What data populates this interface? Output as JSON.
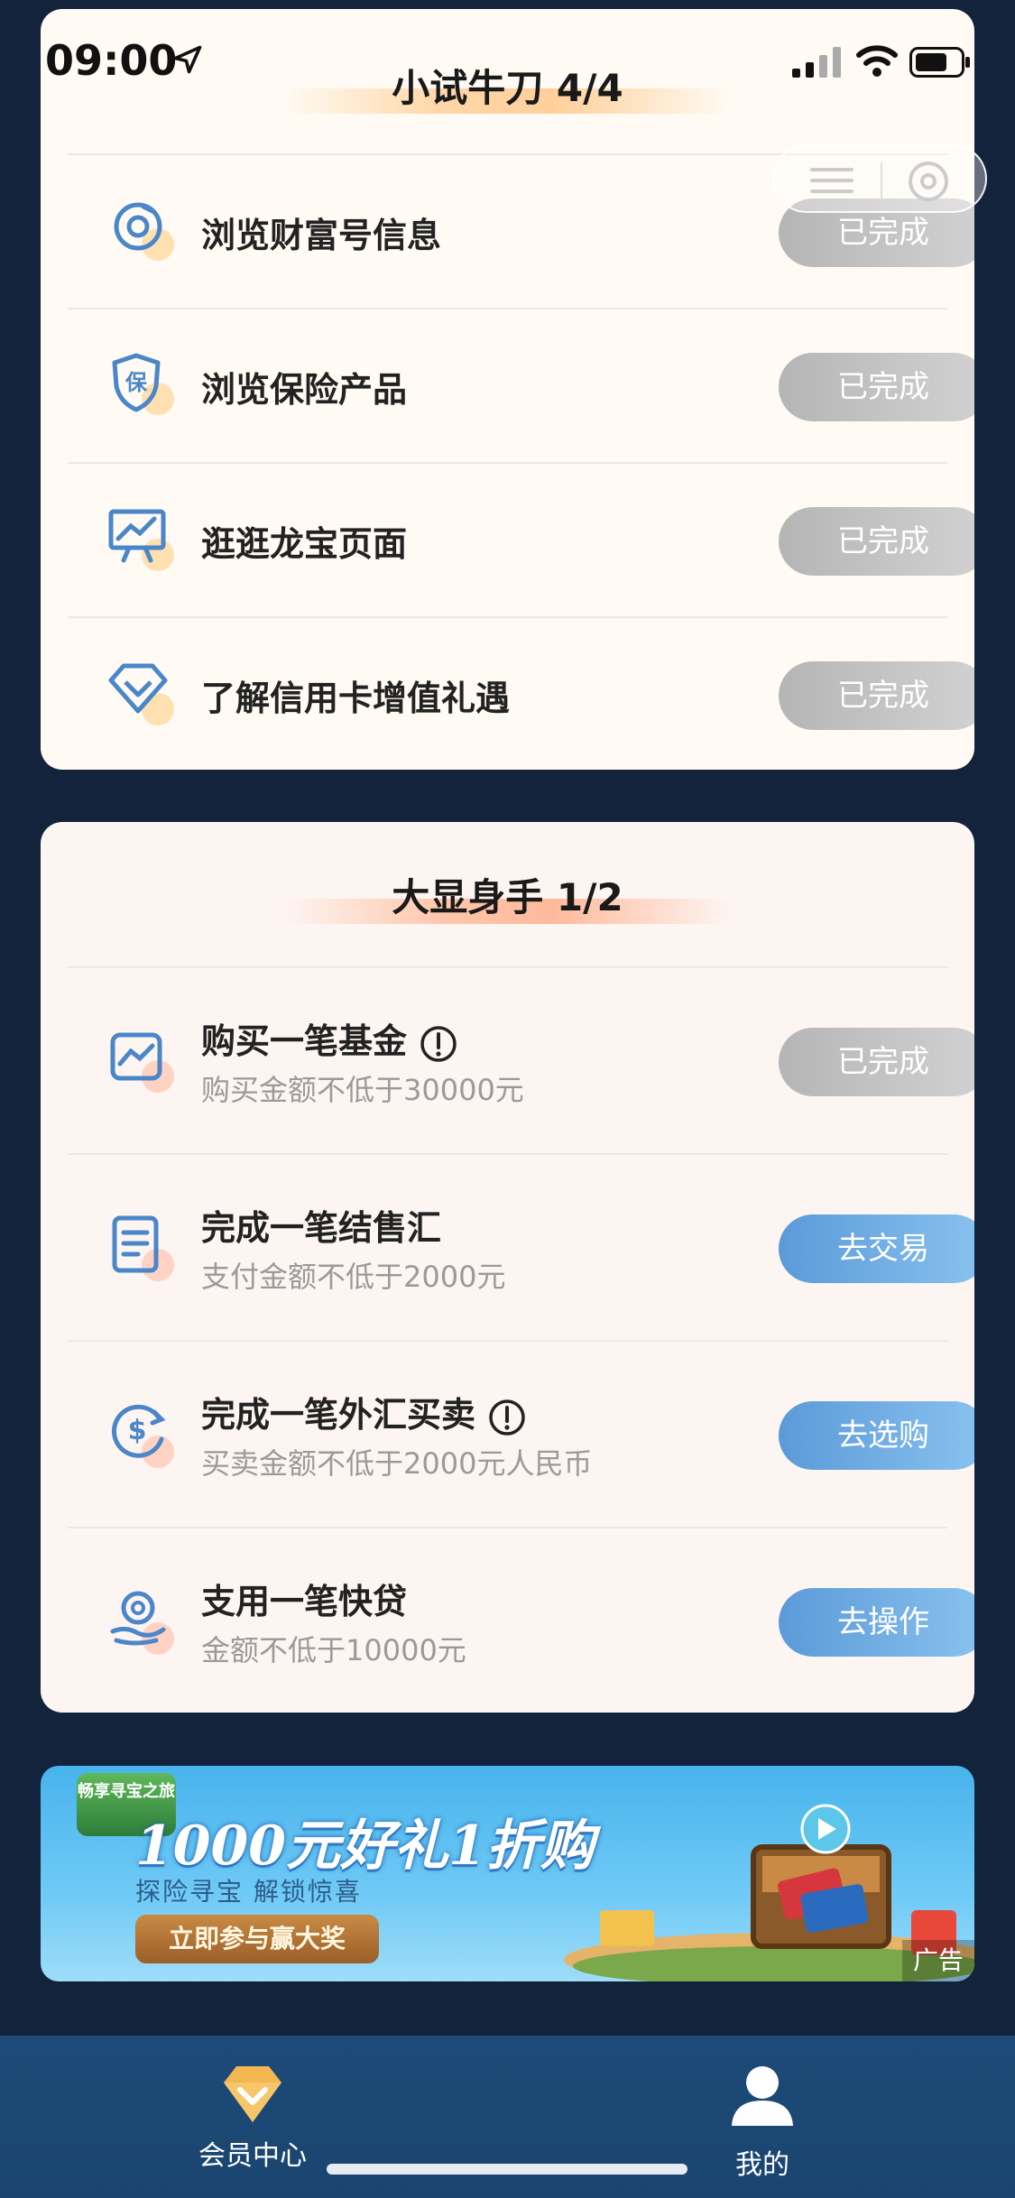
{
  "status_bar": {
    "time": "09:00"
  },
  "section1": {
    "title": "小试牛刀 4/4",
    "tasks": [
      {
        "title": "浏览财富号信息",
        "button": "已完成",
        "icon": "wealth-coin-icon"
      },
      {
        "title": "浏览保险产品",
        "button": "已完成",
        "icon": "insurance-shield-icon"
      },
      {
        "title": "逛逛龙宝页面",
        "button": "已完成",
        "icon": "presentation-chart-icon"
      },
      {
        "title": "了解信用卡增值礼遇",
        "button": "已完成",
        "icon": "diamond-icon"
      }
    ]
  },
  "section2": {
    "title": "大显身手 1/2",
    "tasks": [
      {
        "title": "购买一笔基金",
        "subtitle": "购买金额不低于30000元",
        "button": "已完成",
        "icon": "fund-chart-icon",
        "info": true
      },
      {
        "title": "完成一笔结售汇",
        "subtitle": "支付金额不低于2000元",
        "button": "去交易",
        "icon": "document-icon",
        "info": false
      },
      {
        "title": "完成一笔外汇买卖",
        "subtitle": "买卖金额不低于2000元人民币",
        "button": "去选购",
        "icon": "dollar-exchange-icon",
        "info": true
      },
      {
        "title": "支用一笔快贷",
        "subtitle": "金额不低于10000元",
        "button": "去操作",
        "icon": "loan-hand-icon",
        "info": false
      }
    ]
  },
  "banner": {
    "headline": "1000元好礼1折购",
    "subtitle": "探险寻宝 解锁惊喜",
    "cta": "立即参与赢大奖",
    "logo_text": "畅享寻宝之旅",
    "ad_label": "广告"
  },
  "tab_bar": {
    "items": [
      {
        "label": "会员中心",
        "icon": "diamond-member-icon"
      },
      {
        "label": "我的",
        "icon": "user-icon"
      }
    ]
  },
  "colors": {
    "background": "#13233b",
    "card": "#fffbf4",
    "done_button": "#c4c4c4",
    "action_button": "#6aa9e2",
    "tab_bar": "#1d4a78"
  }
}
